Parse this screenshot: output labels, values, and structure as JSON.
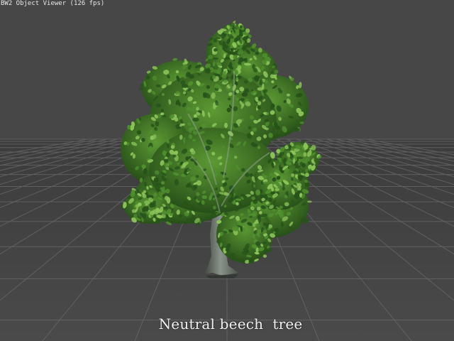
{
  "window": {
    "title": "BW2 Object Viewer (126 fps)"
  },
  "viewport": {
    "caption": "Neutral beech  tree",
    "background_color": "#474747",
    "grid_color": "#6a6a6a",
    "object_icon": "tree-model"
  }
}
